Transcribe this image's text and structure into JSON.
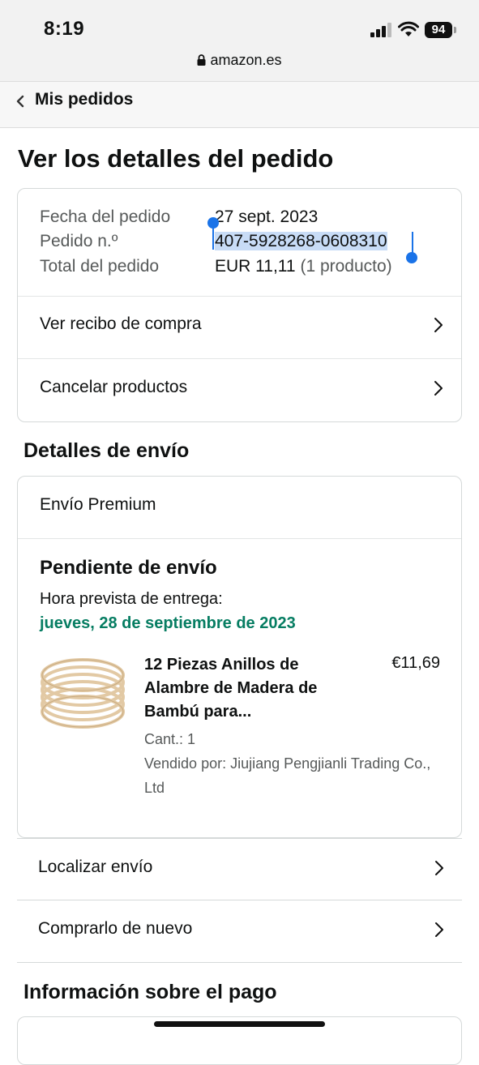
{
  "status_bar": {
    "time": "8:19",
    "battery": "94",
    "url": "amazon.es"
  },
  "nav": {
    "back_label": "Mis pedidos"
  },
  "page_title": "Ver los detalles del pedido",
  "order_summary": {
    "date_label": "Fecha del pedido",
    "date_value": "27 sept. 2023",
    "order_label": "Pedido n.º",
    "order_value": "407-5928268-0608310",
    "total_label": "Total del pedido",
    "total_value": "EUR 11,11",
    "total_count": "(1 producto)",
    "actions": [
      {
        "label": "Ver recibo de compra"
      },
      {
        "label": "Cancelar productos"
      }
    ]
  },
  "shipping": {
    "section_title": "Detalles de envío",
    "method": "Envío Premium",
    "status": "Pendiente de envío",
    "eta_label": "Hora prevista de entrega:",
    "eta_date": "jueves, 28 de septiembre de 2023",
    "product": {
      "title": "12 Piezas Anillos de Alambre de Madera de Bambú para...",
      "price": "€11,69",
      "quantity": "Cant.: 1",
      "seller": "Vendido por: Jiujiang Pengjianli Trading Co., Ltd"
    },
    "actions": [
      {
        "label": "Localizar envío"
      },
      {
        "label": "Comprarlo de nuevo"
      }
    ]
  },
  "payment": {
    "section_title": "Información sobre el pago"
  },
  "colors": {
    "accent_green": "#067d62",
    "selection_blue": "#1a73e8",
    "border": "#d5d9d9"
  }
}
